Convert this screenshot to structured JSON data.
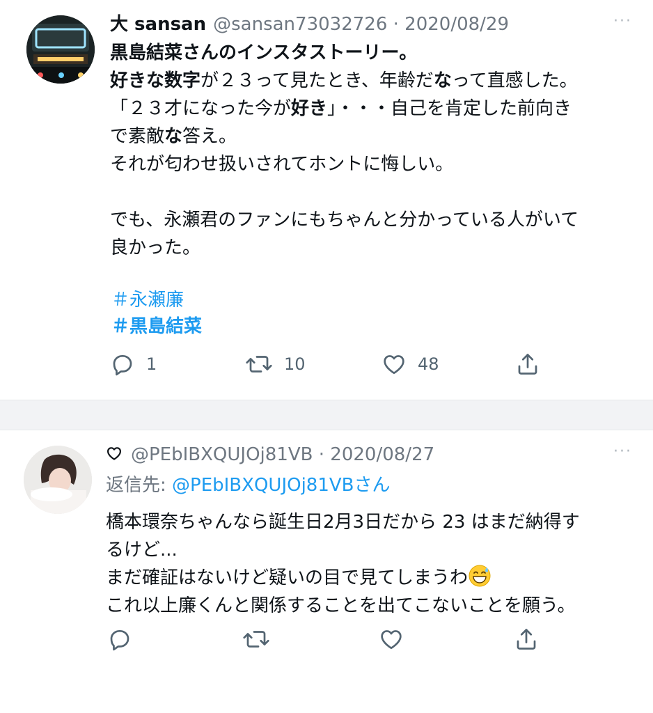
{
  "tweet1": {
    "display_name": "大 sansan",
    "handle": "@sansan73032726",
    "sep": "·",
    "date": "2020/08/29",
    "more": "···",
    "line1": "黒島結菜さんのインスタストーリー。",
    "line2_bold1": "好きな数字",
    "line2_rest1": "が２３って見たとき、年齢だ",
    "line2_bold2": "な",
    "line2_rest2": "って直感した。",
    "line3_pre": "「２３才になった今が",
    "line3_bold": "好き",
    "line3_post": "」・・・自己を肯定した前向き",
    "line4_pre": "で素敵",
    "line4_bold": "な",
    "line4_post": "答え。",
    "line5": "それが匂わせ扱いされてホントに悔しい。",
    "line6": "でも、永瀬君のファンにもちゃんと分かっている人がいて",
    "line7": "良かった。",
    "hashtag1": "＃永瀬廉",
    "hashtag2": "＃黒島結菜",
    "reply_count": "1",
    "retweet_count": "10",
    "like_count": "48"
  },
  "tweet2": {
    "handle": "@PEbIBXQUJOj81VB",
    "sep": "·",
    "date": "2020/08/27",
    "more": "···",
    "reply_prefix": "返信先: ",
    "reply_handle": "@PEbIBXQUJOj81VB",
    "reply_suffix": "さん",
    "line1": "橋本環奈ちゃんなら誕生日2月3日だから 23 はまだ納得す",
    "line2": "るけど...",
    "line3": "まだ確証はないけど疑いの目で見てしまうわ",
    "line4": "これ以上廉くんと関係することを出てこないことを願う。"
  },
  "icons": {
    "reply": "reply-bubble-icon",
    "retweet": "retweet-arrows-icon",
    "like": "heart-outline-icon",
    "share": "share-upload-icon",
    "emoji": "grinning-sweat-emoji-icon"
  },
  "colors": {
    "link": "#1d9bf0",
    "text": "#0f1419",
    "muted": "#6e7781",
    "separator": "#f2f3f5"
  }
}
